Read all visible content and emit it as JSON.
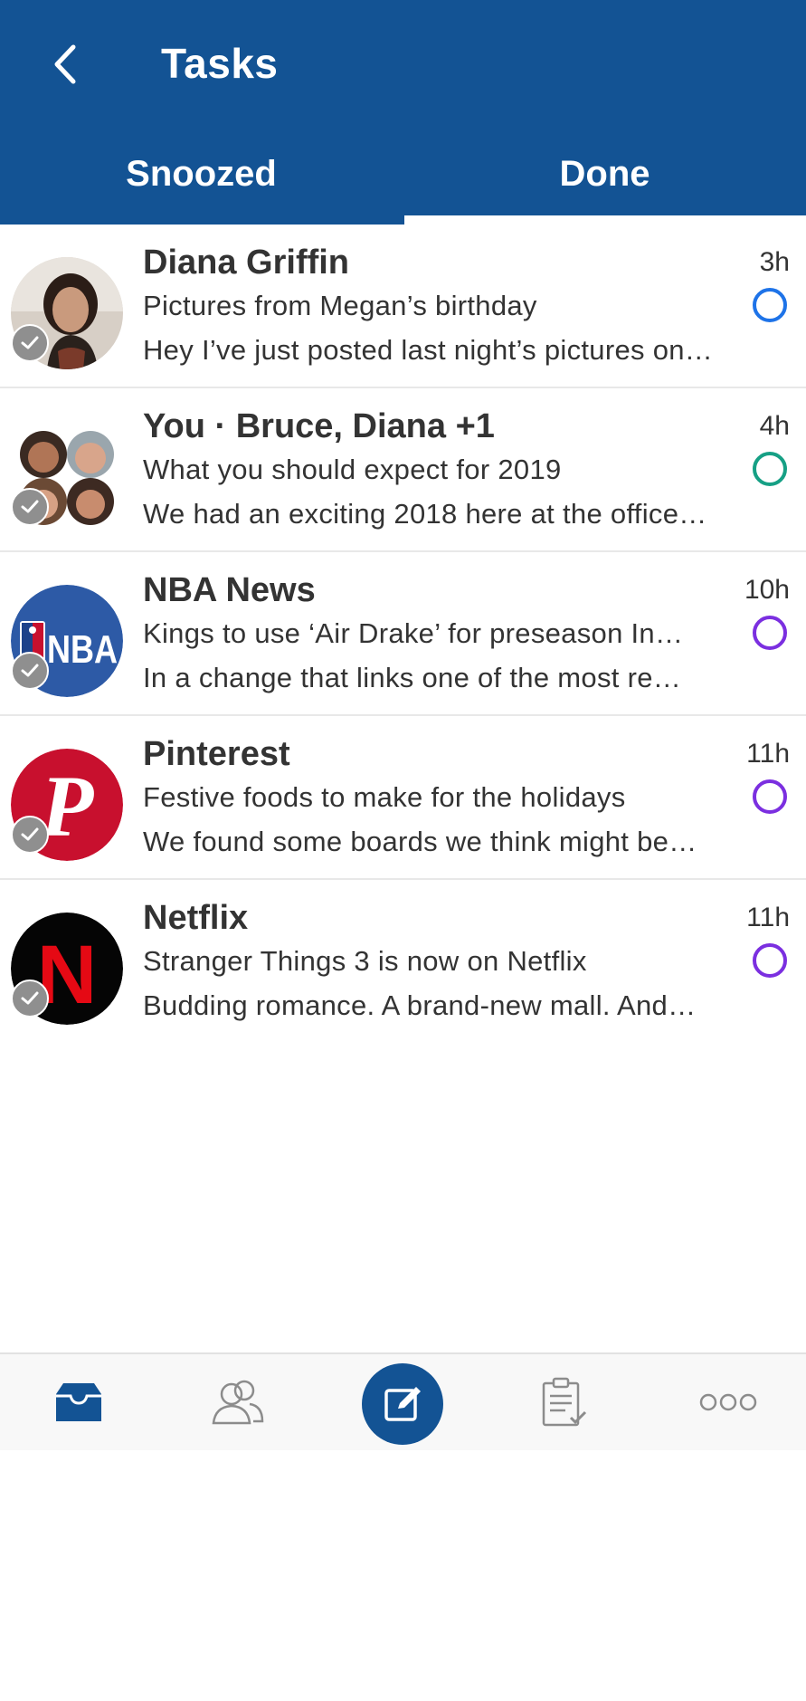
{
  "header": {
    "title": "Tasks",
    "tabs": [
      {
        "label": "Snoozed"
      },
      {
        "label": "Done"
      }
    ],
    "active_tab": "Done"
  },
  "items": [
    {
      "sender": "Diana Griffin",
      "subject": "Pictures from Megan’s birthday",
      "preview": "Hey I’ve just posted last night’s pictures on…",
      "time": "3h",
      "circle_color": "#1e73e8",
      "avatar": "photo-woman"
    },
    {
      "sender": "You · Bruce, Diana +1",
      "subject": "What you should expect for 2019",
      "preview": "We had an exciting 2018 here at the office…",
      "time": "4h",
      "circle_color": "#16a085",
      "avatar": "group-photos"
    },
    {
      "sender": "NBA News",
      "subject": "Kings to use ‘Air Drake’ for preseason In…",
      "preview": "In a change that links one of the most re…",
      "time": "10h",
      "circle_color": "#7b2fe0",
      "avatar": "nba-logo",
      "logo_text": "NBA"
    },
    {
      "sender": "Pinterest",
      "subject": "Festive foods to make for the holidays",
      "preview": "We found some boards we think might be…",
      "time": "11h",
      "circle_color": "#7b2fe0",
      "avatar": "pinterest-logo",
      "logo_text": "P"
    },
    {
      "sender": "Netflix",
      "subject": "Stranger Things 3 is now on Netflix",
      "preview": "Budding romance. A brand-new mall. And…",
      "time": "11h",
      "circle_color": "#7b2fe0",
      "avatar": "netflix-logo",
      "logo_text": "N"
    }
  ],
  "bottom_nav": [
    {
      "icon": "inbox-icon"
    },
    {
      "icon": "people-icon"
    },
    {
      "icon": "compose-icon"
    },
    {
      "icon": "tasks-icon"
    },
    {
      "icon": "more-icon"
    }
  ],
  "colors": {
    "brand": "#135394",
    "background": "#eeeeee"
  }
}
